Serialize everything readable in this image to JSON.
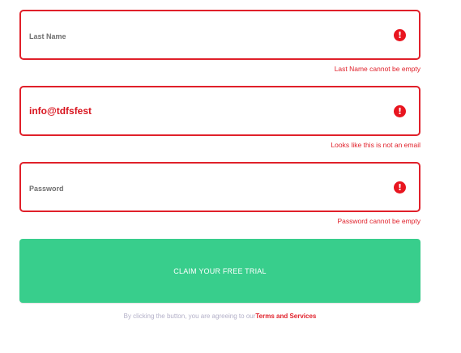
{
  "form": {
    "last_name": {
      "placeholder": "Last Name",
      "value": "",
      "error": "Last Name cannot be empty"
    },
    "email": {
      "placeholder": "",
      "value": "info@tdfsfest",
      "error": "Looks like this is not an email"
    },
    "password": {
      "placeholder": "Password",
      "value": "",
      "error": "Password cannot be empty"
    },
    "error_icon": {
      "name": "exclamation-circle-icon",
      "glyph": "!",
      "color": "#e8151f"
    },
    "submit_label": "CLAIM YOUR FREE TRIAL",
    "consent_text": "By clicking the button, you are agreeing to our",
    "terms_link": "Terms and Services"
  },
  "colors": {
    "error": "#e0202a",
    "button": "#38ce8c",
    "muted_text": "#b3b0c8"
  }
}
